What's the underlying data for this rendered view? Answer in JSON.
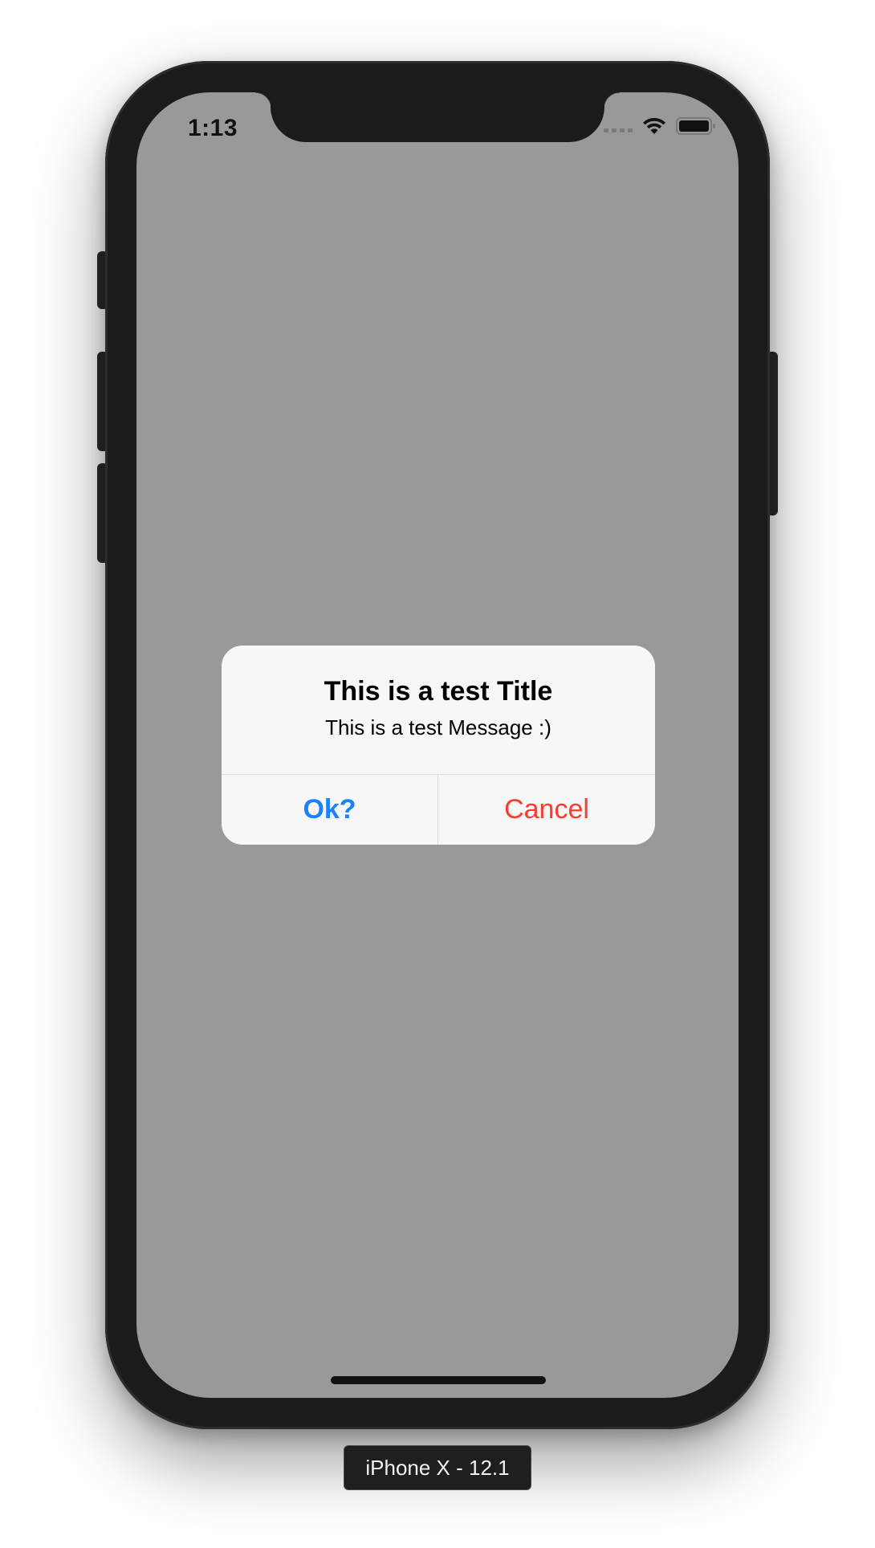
{
  "status_bar": {
    "time": "1:13",
    "icons": [
      "cellular-signal-icon",
      "wifi-icon",
      "battery-icon"
    ]
  },
  "screen": {
    "background_color": "#999999"
  },
  "alert": {
    "title": "This is a test Title",
    "message": "This is a test Message :)",
    "buttons": [
      {
        "label": "Ok?",
        "color": "#1a82fb"
      },
      {
        "label": "Cancel",
        "color": "#fb3b30"
      }
    ]
  },
  "simulator": {
    "device_label": "iPhone X - 12.1"
  }
}
